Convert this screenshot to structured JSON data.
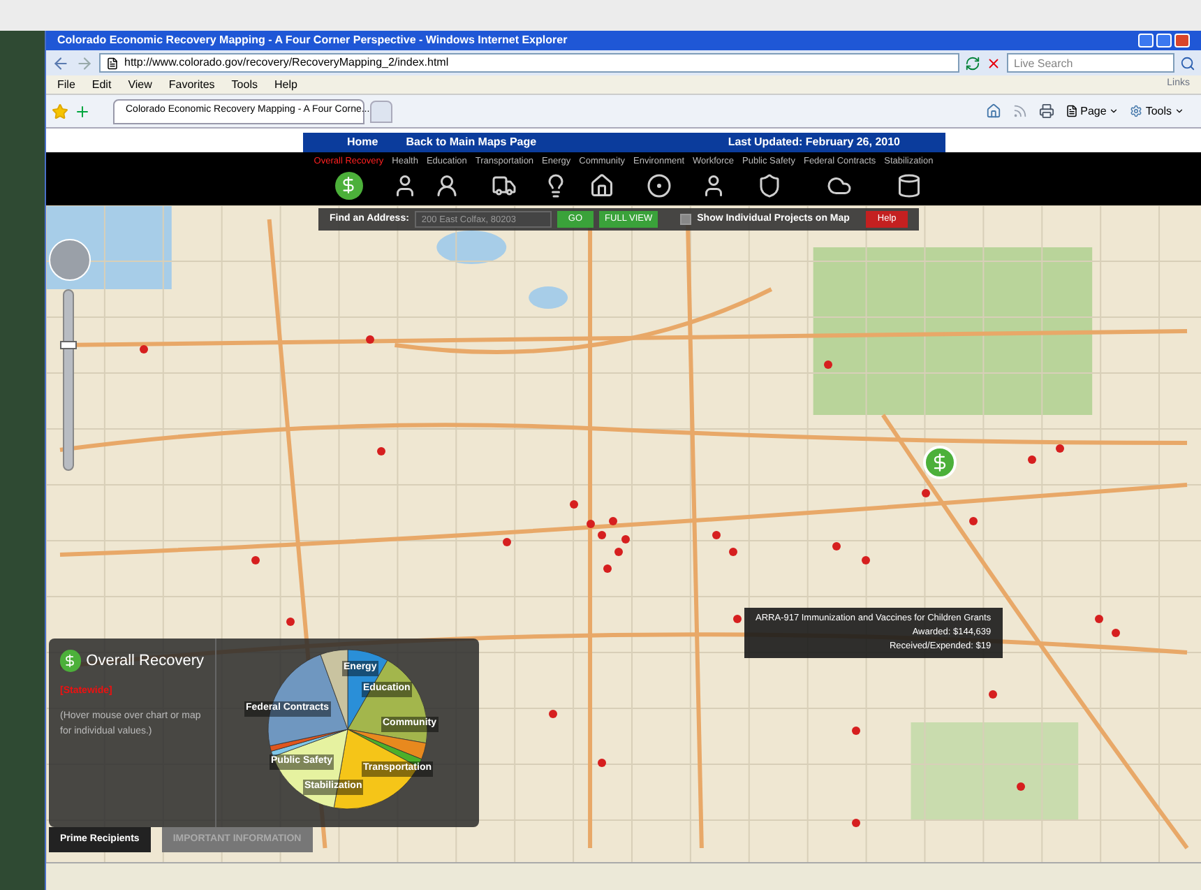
{
  "window": {
    "title": "Colorado Economic Recovery Mapping - A Four Corner Perspective - Windows Internet Explorer"
  },
  "address_bar": {
    "url": "http://www.colorado.gov/recovery/RecoveryMapping_2/index.html"
  },
  "search": {
    "placeholder": "Live Search"
  },
  "menu": [
    "File",
    "Edit",
    "View",
    "Favorites",
    "Tools",
    "Help"
  ],
  "links_label": "Links",
  "tab": {
    "title": "Colorado Economic Recovery Mapping - A Four Corne..."
  },
  "toolbar": [
    "Page",
    "Tools"
  ],
  "header": {
    "links": [
      "Home",
      "Back to Main Maps Page"
    ],
    "last_updated": "Last Updated: February 26, 2010"
  },
  "categories": [
    {
      "label": "Overall Recovery",
      "selected": true
    },
    {
      "label": "Health",
      "selected": false
    },
    {
      "label": "Education",
      "selected": false
    },
    {
      "label": "Transportation",
      "selected": false
    },
    {
      "label": "Energy",
      "selected": false
    },
    {
      "label": "Community",
      "selected": false
    },
    {
      "label": "Environment",
      "selected": false
    },
    {
      "label": "Workforce",
      "selected": false
    },
    {
      "label": "Public Safety",
      "selected": false
    },
    {
      "label": "Federal Contracts",
      "selected": false
    },
    {
      "label": "Stabilization",
      "selected": false
    }
  ],
  "find_bar": {
    "label": "Find an Address:",
    "placeholder": "200 East Colfax, 80203",
    "go": "GO",
    "full_view": "FULL VIEW",
    "checkbox": {
      "label": "Show Individual Projects on Map",
      "checked": true
    },
    "help": "Help"
  },
  "map": {
    "zoom": {
      "level": 0.7
    }
  },
  "tooltip": {
    "lines": [
      "ARRA-917 Immunization and Vaccines for Children Grants",
      "Awarded: $144,639",
      "Received/Expended: $19"
    ]
  },
  "panel": {
    "title": "Overall Recovery",
    "scope": "[Statewide]",
    "hint": "(Hover mouse over chart or map for individual values.)",
    "pie_labels": [
      "Energy",
      "Education",
      "Federal Contracts",
      "Community",
      "Public Safety",
      "Transportation",
      "Stabilization"
    ],
    "tabs": [
      {
        "label": "Prime Recipients",
        "selected": true
      },
      {
        "label": "IMPORTANT INFORMATION",
        "selected": false
      }
    ]
  }
}
